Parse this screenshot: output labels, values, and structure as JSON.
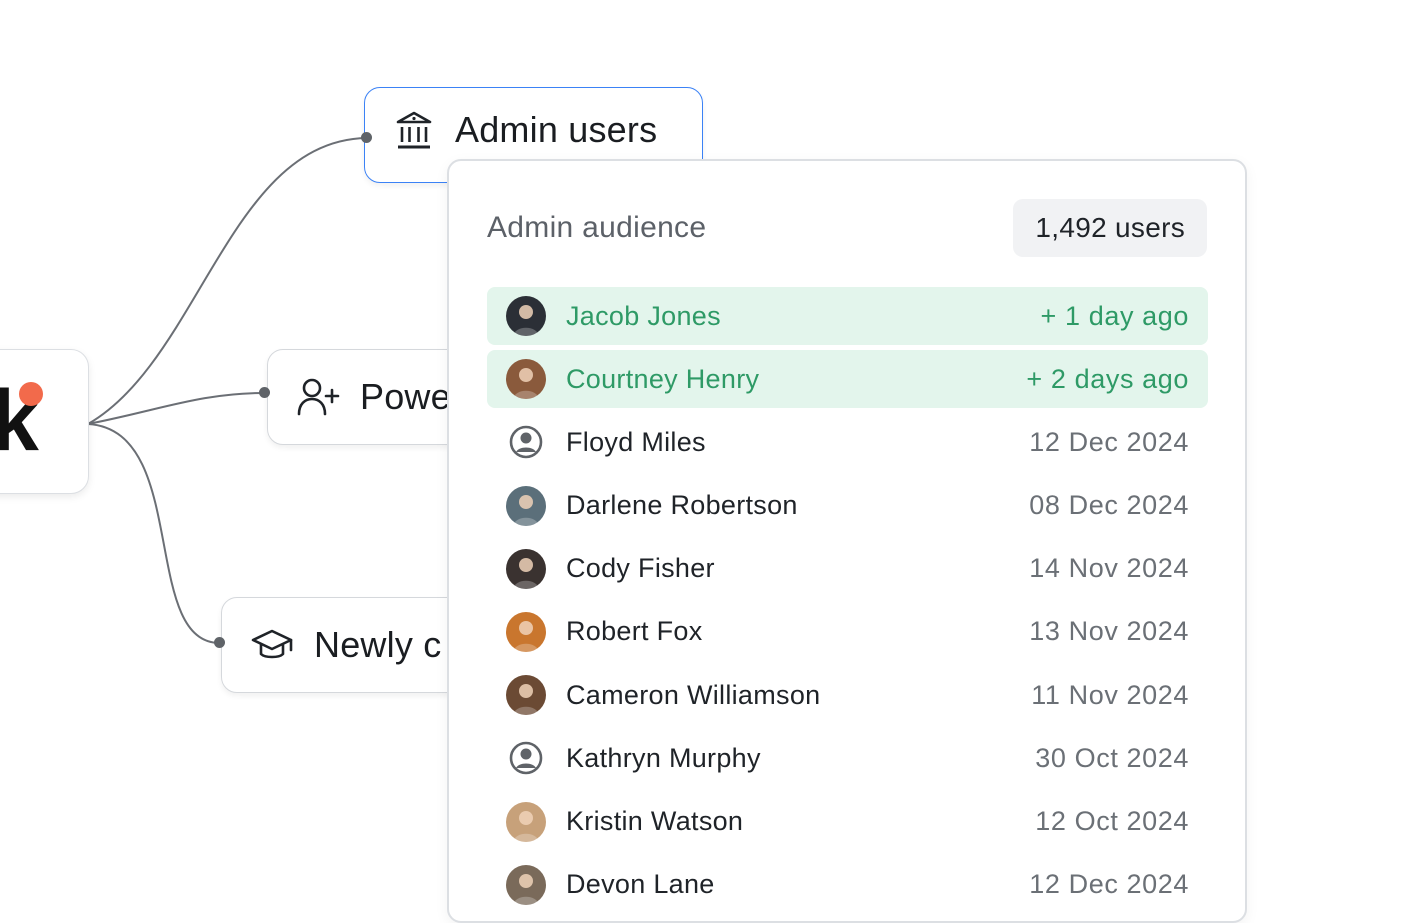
{
  "nodes": {
    "admin": {
      "label": "Admin users",
      "icon": "bank-icon"
    },
    "power": {
      "label": "Power",
      "icon": "user-plus-icon"
    },
    "newly": {
      "label": "Newly c",
      "icon": "graduation-cap-icon"
    }
  },
  "root": {
    "logo_letter": "k",
    "accent_color": "#f26a4b"
  },
  "panel": {
    "title": "Admin audience",
    "count": "1,492 users",
    "users": [
      {
        "name": "Jacob Jones",
        "date": "+ 1 day ago",
        "recent": true,
        "avatar_color": "#2b2f36",
        "avatar": "photo"
      },
      {
        "name": "Courtney Henry",
        "date": "+ 2 days ago",
        "recent": true,
        "avatar_color": "#8a5a3c",
        "avatar": "photo"
      },
      {
        "name": "Floyd Miles",
        "date": "12 Dec 2024",
        "recent": false,
        "avatar_color": "#5f6368",
        "avatar": "placeholder"
      },
      {
        "name": "Darlene Robertson",
        "date": "08 Dec 2024",
        "recent": false,
        "avatar_color": "#5b6f7a",
        "avatar": "photo"
      },
      {
        "name": "Cody Fisher",
        "date": "14 Nov 2024",
        "recent": false,
        "avatar_color": "#3a3230",
        "avatar": "photo"
      },
      {
        "name": "Robert Fox",
        "date": "13 Nov 2024",
        "recent": false,
        "avatar_color": "#c9762e",
        "avatar": "photo"
      },
      {
        "name": "Cameron Williamson",
        "date": "11 Nov 2024",
        "recent": false,
        "avatar_color": "#6b4a34",
        "avatar": "photo"
      },
      {
        "name": "Kathryn Murphy",
        "date": "30 Oct 2024",
        "recent": false,
        "avatar_color": "#5f6368",
        "avatar": "placeholder"
      },
      {
        "name": "Kristin Watson",
        "date": "12 Oct 2024",
        "recent": false,
        "avatar_color": "#c7a17a",
        "avatar": "photo"
      },
      {
        "name": "Devon Lane",
        "date": "12 Dec 2024",
        "recent": false,
        "avatar_color": "#7a6a5a",
        "avatar": "photo"
      }
    ]
  },
  "colors": {
    "accent_blue": "#3b82f6",
    "recent_bg": "#e3f5ec",
    "recent_text": "#2e9a66"
  }
}
